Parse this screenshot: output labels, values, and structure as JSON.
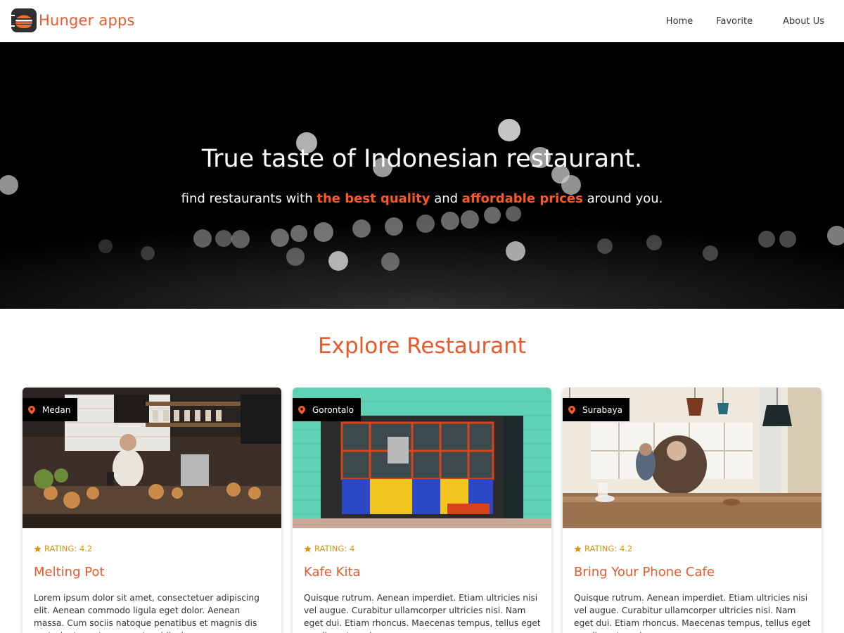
{
  "brand": {
    "name": "Hunger apps",
    "logo_icon": "burger-logo-icon",
    "accent": "#e9592b"
  },
  "nav": {
    "items": [
      "Home",
      "Favorite",
      "About Us"
    ]
  },
  "hero": {
    "title": "True taste of Indonesian restaurant.",
    "subtitle": {
      "part1": "find restaurants with ",
      "highlight1": "the best quality",
      "part2": " and ",
      "highlight2": "affordable prices",
      "part3": " around you."
    },
    "highlight_color": "#ff5722"
  },
  "explore": {
    "title": "Explore Restaurant",
    "restaurants": [
      {
        "city": "Medan",
        "rating_label": "RATING: 4.2",
        "name": "Melting Pot",
        "description": "Lorem ipsum dolor sit amet, consectetuer adipiscing elit. Aenean commodo ligula eget dolor. Aenean massa. Cum sociis natoque penatibus et magnis dis parturient montes, nascetur ridiculus mus."
      },
      {
        "city": "Gorontalo",
        "rating_label": "RATING: 4",
        "name": "Kafe Kita",
        "description": "Quisque rutrum. Aenean imperdiet. Etiam ultricies nisi vel augue. Curabitur ullamcorper ultricies nisi. Nam eget dui. Etiam rhoncus. Maecenas tempus, tellus eget condimentum rhoncus."
      },
      {
        "city": "Surabaya",
        "rating_label": "RATING: 4.2",
        "name": "Bring Your Phone Cafe",
        "description": "Quisque rutrum. Aenean imperdiet. Etiam ultricies nisi vel augue. Curabitur ullamcorper ultricies nisi. Nam eget dui. Etiam rhoncus. Maecenas tempus, tellus eget condimentum rhoncus."
      }
    ]
  },
  "icons": {
    "location": "map-pin-icon",
    "rating": "star-icon"
  },
  "colors": {
    "rating": "#d4920e",
    "badge_bg": "#000000"
  }
}
